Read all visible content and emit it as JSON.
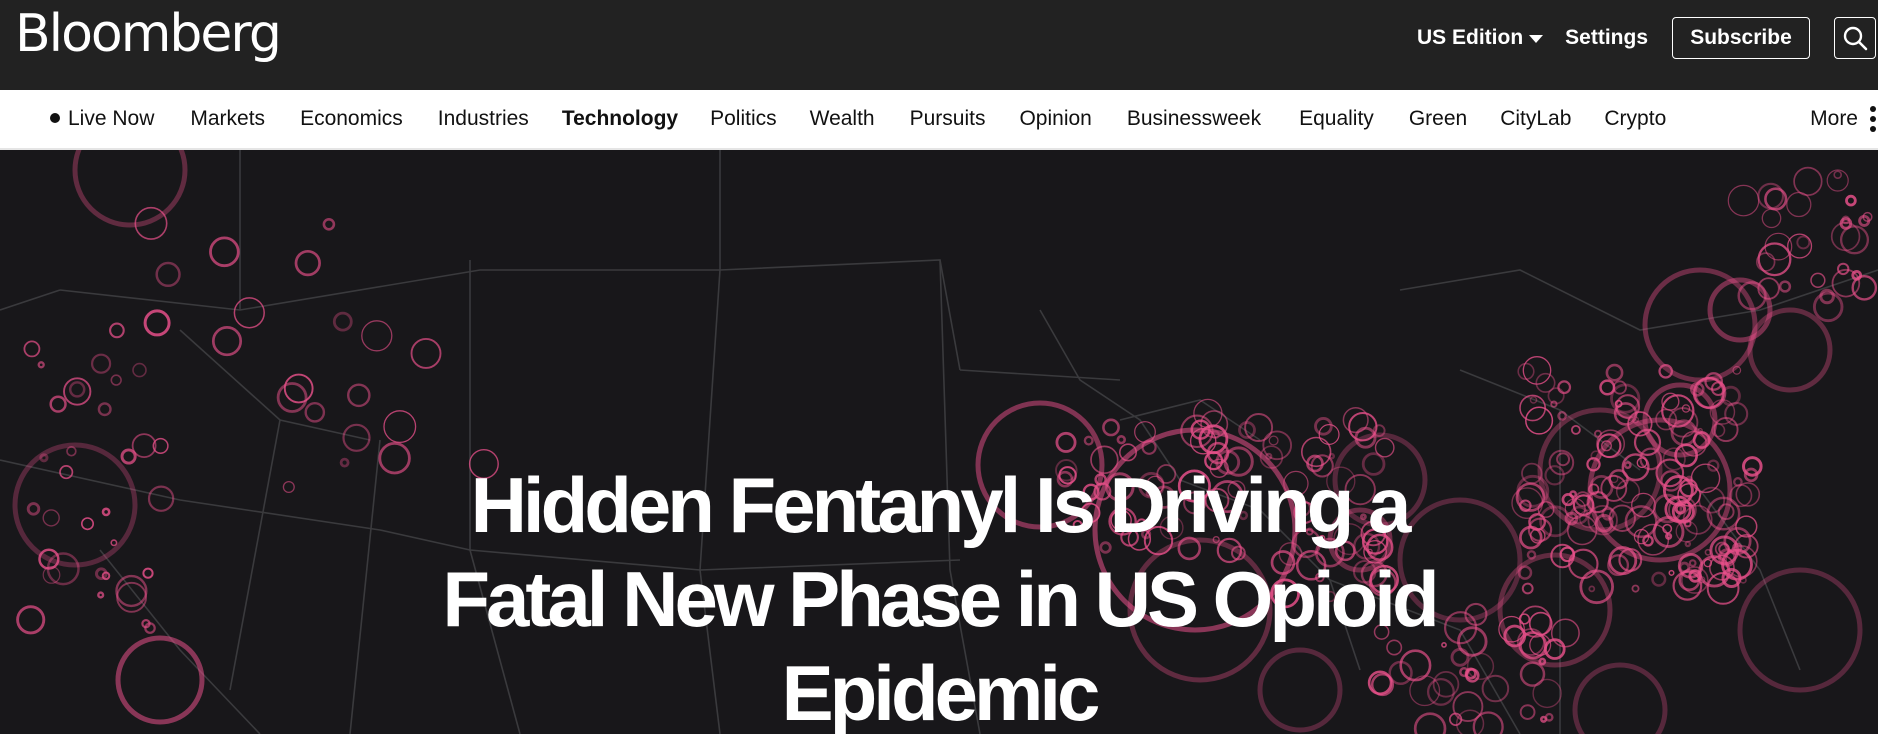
{
  "header": {
    "logo": "Bloomberg",
    "edition_label": "US Edition",
    "settings_label": "Settings",
    "subscribe_label": "Subscribe"
  },
  "nav": {
    "items": [
      {
        "label": "Live Now",
        "live": true
      },
      {
        "label": "Markets"
      },
      {
        "label": "Economics"
      },
      {
        "label": "Industries"
      },
      {
        "label": "Technology",
        "active": true
      },
      {
        "label": "Politics"
      },
      {
        "label": "Wealth"
      },
      {
        "label": "Pursuits"
      },
      {
        "label": "Opinion"
      },
      {
        "label": "Businessweek"
      },
      {
        "label": "Equality"
      },
      {
        "label": "Green"
      },
      {
        "label": "CityLab"
      },
      {
        "label": "Crypto"
      }
    ],
    "more_label": "More"
  },
  "hero": {
    "headline": "Hidden Fentanyl Is Driving a Fatal New Phase in US Opioid Epidemic"
  },
  "colors": {
    "header_bg": "#222222",
    "hero_bg": "#18171a",
    "accent_pink": "#e8508a",
    "map_lines": "#3a3a3d"
  }
}
